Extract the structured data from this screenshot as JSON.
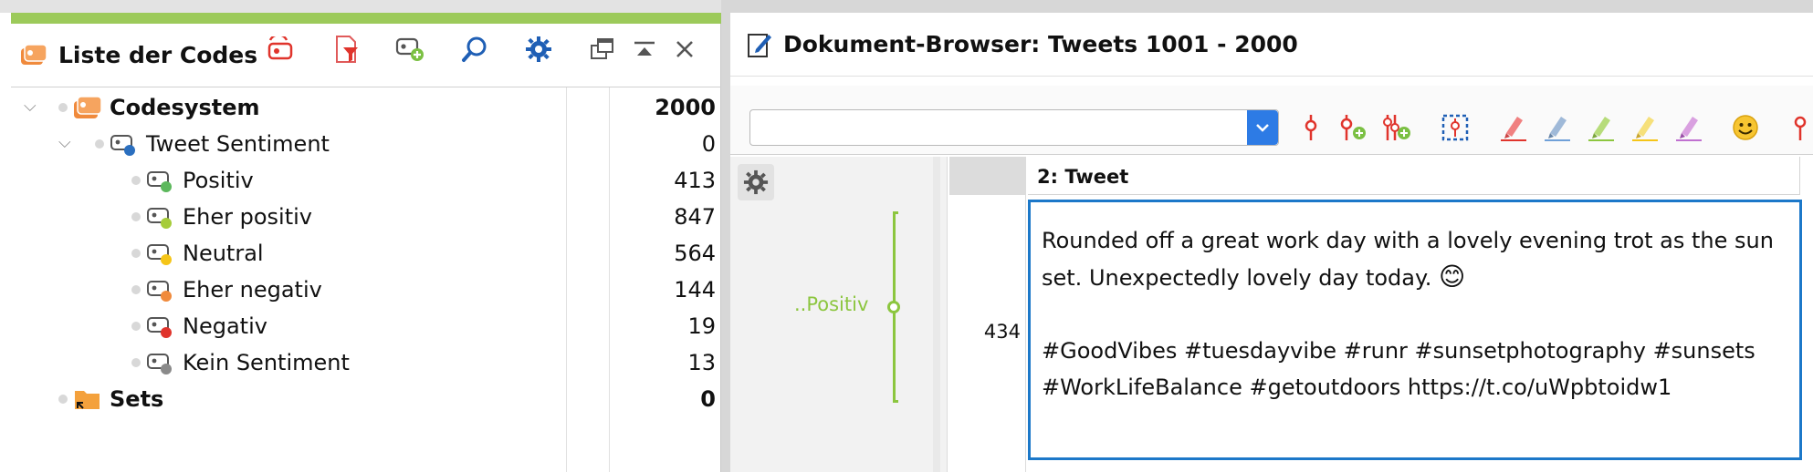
{
  "left_panel": {
    "title": "Liste der Codes",
    "tree": [
      {
        "label": "Codesystem",
        "count": "2000",
        "bold": true,
        "color": "#f08a3c"
      },
      {
        "label": "Tweet Sentiment",
        "count": "0",
        "bold": false,
        "color": "#2b6fbf"
      },
      {
        "label": "Positiv",
        "count": "413",
        "bold": false,
        "color": "#5cb85c"
      },
      {
        "label": "Eher positiv",
        "count": "847",
        "bold": false,
        "color": "#a6cc3a"
      },
      {
        "label": "Neutral",
        "count": "564",
        "bold": false,
        "color": "#f5c518"
      },
      {
        "label": "Eher negativ",
        "count": "144",
        "bold": false,
        "color": "#f08a3c"
      },
      {
        "label": "Negativ",
        "count": "19",
        "bold": false,
        "color": "#e0342c"
      },
      {
        "label": "Kein Sentiment",
        "count": "13",
        "bold": false,
        "color": "#8a8a8a"
      },
      {
        "label": "Sets",
        "count": "0",
        "bold": true,
        "color": "#f4a13c"
      }
    ]
  },
  "right_panel": {
    "title": "Dokument-Browser: Tweets 1001 - 2000",
    "column_header": "2: Tweet",
    "row_number": "434",
    "code_label": "..Positiv",
    "tweet_line1": "Rounded off a great work day with a lovely evening trot as the sun set. Unexpectedly lovely day today.",
    "tweet_emoji": "😊",
    "tweet_line2": "#GoodVibes #tuesdayvibe #runr #sunsetphotography #sunsets #WorkLifeBalance #getoutdoors https://t.co/uWpbtoidw1"
  },
  "colors": {
    "accent_green": "#9cca5a",
    "selection_blue": "#1c78c9",
    "combo_blue": "#2d7be5",
    "code_green": "#8cc63f"
  }
}
